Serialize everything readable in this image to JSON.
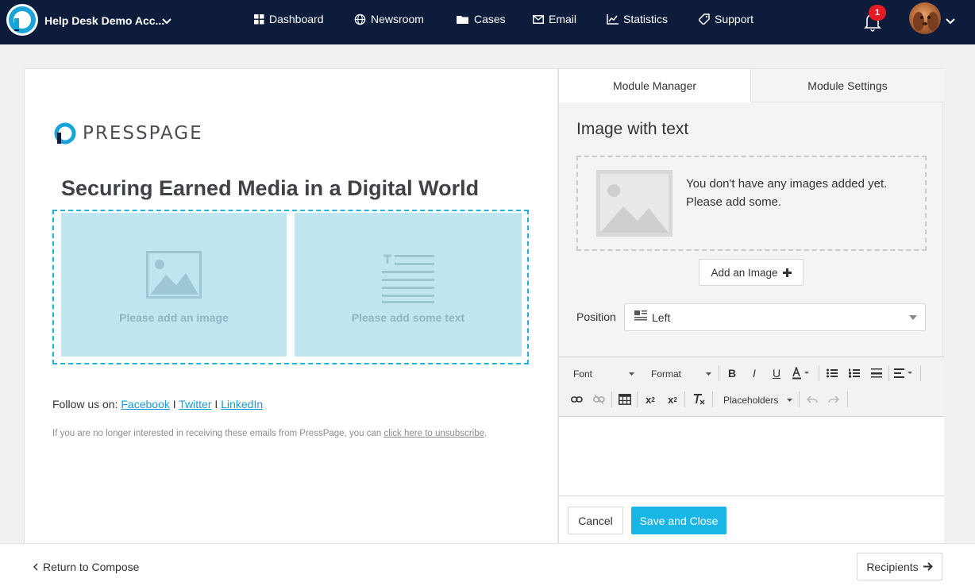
{
  "nav": {
    "account": "Help Desk Demo Acc...",
    "items": [
      {
        "label": "Dashboard",
        "icon": "grid-icon"
      },
      {
        "label": "Newsroom",
        "icon": "globe-icon"
      },
      {
        "label": "Cases",
        "icon": "folder-icon"
      },
      {
        "label": "Email",
        "icon": "envelope-icon"
      },
      {
        "label": "Statistics",
        "icon": "chart-icon"
      },
      {
        "label": "Support",
        "icon": "tag-icon"
      }
    ],
    "notifications": "1"
  },
  "preview": {
    "logo_text": "PRESSPAGE",
    "headline": "Securing Earned Media in a Digital World",
    "image_placeholder": "Please add an image",
    "text_placeholder": "Please add some text",
    "follow_prefix": "Follow us on:",
    "links": [
      "Facebook",
      "Twitter",
      "LinkedIn"
    ],
    "separator": "I",
    "unsub_text": "If you are no longer interested in receiving these emails from PressPage, you can",
    "unsub_link": "click here to unsubscribe",
    "unsub_end": "."
  },
  "panel": {
    "tabs": [
      "Module Manager",
      "Module Settings"
    ],
    "title": "Image with text",
    "empty_line1": "You don't have any images added yet.",
    "empty_line2": "Please add some.",
    "add_image": "Add an Image",
    "position_label": "Position",
    "position_value": "Left",
    "toolbar": {
      "font": "Font",
      "format": "Format",
      "placeholders": "Placeholders"
    },
    "cancel": "Cancel",
    "save": "Save and Close"
  },
  "bottom": {
    "return": "Return to Compose",
    "recipients": "Recipients"
  },
  "colors": {
    "nav_bg": "#0c1c3a",
    "accent": "#17b6e4",
    "placeholder_bg": "#bfe6f1",
    "badge": "#e21b25"
  }
}
